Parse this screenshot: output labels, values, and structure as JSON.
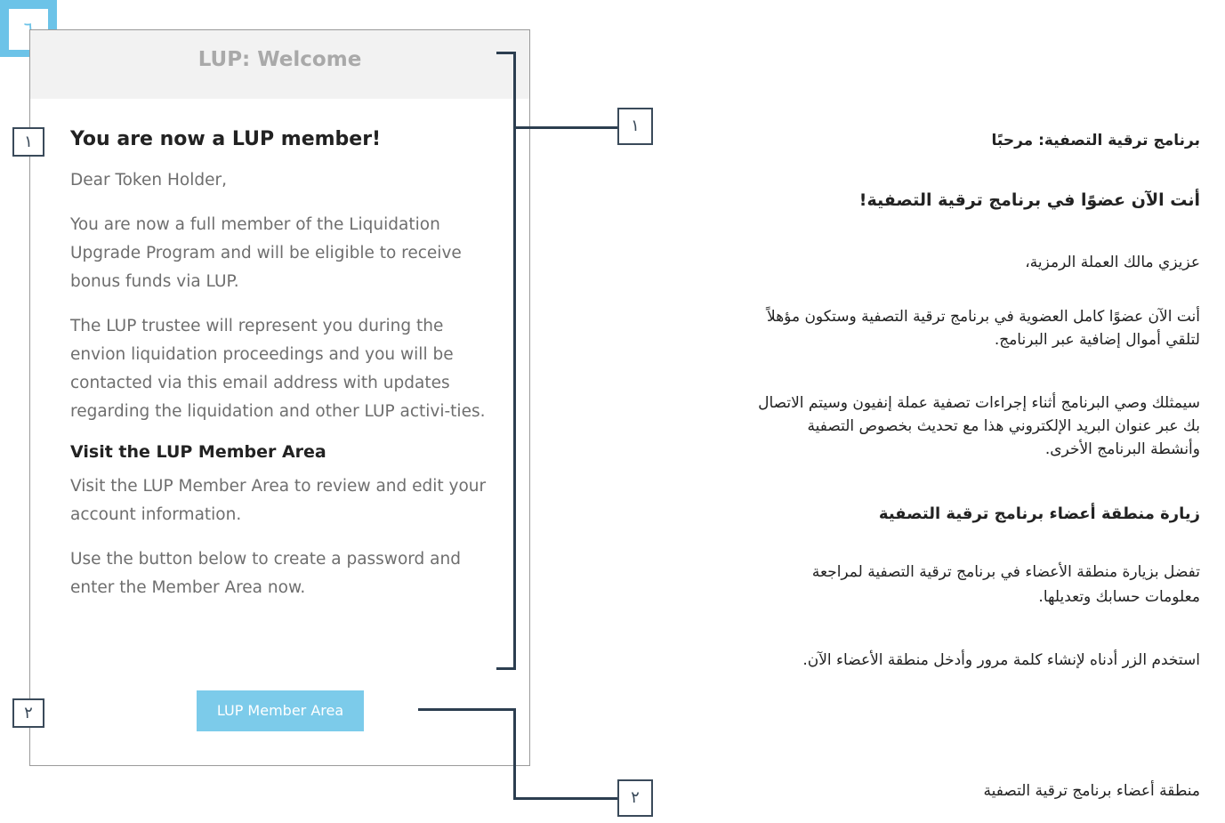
{
  "page_badge": "٦",
  "email": {
    "header_title": "LUP: Welcome",
    "heading": "You are now a LUP member!",
    "greeting": "Dear Token Holder,",
    "para1": "You are now a full member of the Liquidation Upgrade Program and will be eligible to receive bonus funds via LUP.",
    "para2": "The LUP trustee will represent you during the envion liquidation proceedings and you will be contacted via this email address with updates regarding the liquidation and other LUP activi-ties.",
    "subheading": "Visit the LUP Member Area",
    "para3": "Visit the LUP Member Area to review and edit your account information.",
    "para4": "Use the button below to create a password and enter the Member Area now.",
    "button_label": "LUP Member Area"
  },
  "callouts": {
    "one_left": "١",
    "two_left": "٢",
    "one_right": "١",
    "two_right": "٢"
  },
  "arabic": {
    "title": "برنامج ترقية التصفية: مرحبًا",
    "heading": "أنت الآن عضوًا في برنامج ترقية التصفية!",
    "greeting": "عزيزي مالك العملة الرمزية،",
    "para1_line1": "أنت الآن عضوًا كامل العضوية في برنامج ترقية التصفية وستكون مؤهلاً",
    "para1_line2": "لتلقي أموال إضافية عبر البرنامج.",
    "para2_line1": "سيمثلك وصي البرنامج أثناء إجراءات تصفية عملة إنفيون وسيتم الاتصال",
    "para2_line2": "بك عبر عنوان البريد الإلكتروني هذا مع تحديث بخصوص التصفية",
    "para2_line3": "وأنشطة البرنامج الأخرى.",
    "subheading": "زيارة منطقة أعضاء برنامج ترقية التصفية",
    "para3_line1": "تفضل بزيارة منطقة الأعضاء في برنامج ترقية التصفية لمراجعة",
    "para3_line2": "معلومات حسابك وتعديلها.",
    "para4": "استخدم الزر أدناه لإنشاء كلمة مرور وأدخل منطقة الأعضاء الآن.",
    "button_caption": "منطقة أعضاء برنامج ترقية التصفية"
  },
  "colors": {
    "accent": "#6cc3e8",
    "button": "#7ccbea",
    "callout_line": "#2c3e50"
  }
}
